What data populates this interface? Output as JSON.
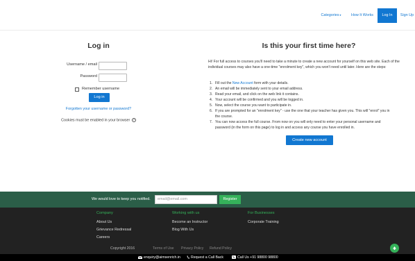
{
  "nav": {
    "categories": "Categories",
    "how_it_works": "How It Works",
    "login": "Log In",
    "signup": "Sign Up"
  },
  "login": {
    "title": "Log in",
    "username_label": "Username / email",
    "password_label": "Password",
    "remember_label": "Remember username",
    "button": "Log in",
    "forgot": "Forgotten your username or password?",
    "cookies": "Cookies must be enabled in your browser"
  },
  "signup": {
    "title": "Is this your first time here?",
    "intro": "Hi! For full access to courses you'll need to take a minute to create a new account for yourself on this web site. Each of the individual courses may also have a one-time \"enrolment key\", which you won't need until later. Here are the steps:",
    "step1_pre": "Fill out the ",
    "step1_link": "New Account",
    "step1_post": " form with your details.",
    "step2": "An email will be immediately sent to your email address.",
    "step3": "Read your email, and click on the web link it contains.",
    "step4": "Your account will be confirmed and you will be logged in.",
    "step5": "Now, select the course you want to participate in.",
    "step6a": "If you are prompted for an \"enrolment key\" - use the one that your teacher has given you. This will \"enrol\" you in",
    "step6b": "the course.",
    "step7a": "You can now access the full course. From now on you will only need to enter your personal username and",
    "step7b": "password (in the form on this page) to log in and access any course you have enrolled in.",
    "button": "Create new account"
  },
  "newsletter": {
    "text": "We would love to keep you notified.",
    "placeholder": "email@email.com",
    "button": "Register"
  },
  "footer": {
    "col1": {
      "heading": "Company",
      "links": [
        "About Us",
        "Grievance Redressal",
        "Careers"
      ]
    },
    "col2": {
      "heading": "Working with us",
      "links": [
        "Become an Instructor",
        "Blog With Us"
      ]
    },
    "col3": {
      "heading": "For Businesses",
      "links": [
        "Corporate Training"
      ]
    },
    "copyright": "Copyright 2016",
    "terms": "Terms of Use",
    "privacy": "Privacy Policy",
    "refund": "Refund Policy"
  },
  "contact": {
    "email": "enquiry@aimsenrich.in",
    "callback": "Request a Call Back",
    "phone": "Call Us +91 98800 98800"
  },
  "colors": {
    "accent": "#1177d1",
    "newsletter_bg": "#2b5e48",
    "green": "#35b25a",
    "footer_bg": "#222222"
  }
}
